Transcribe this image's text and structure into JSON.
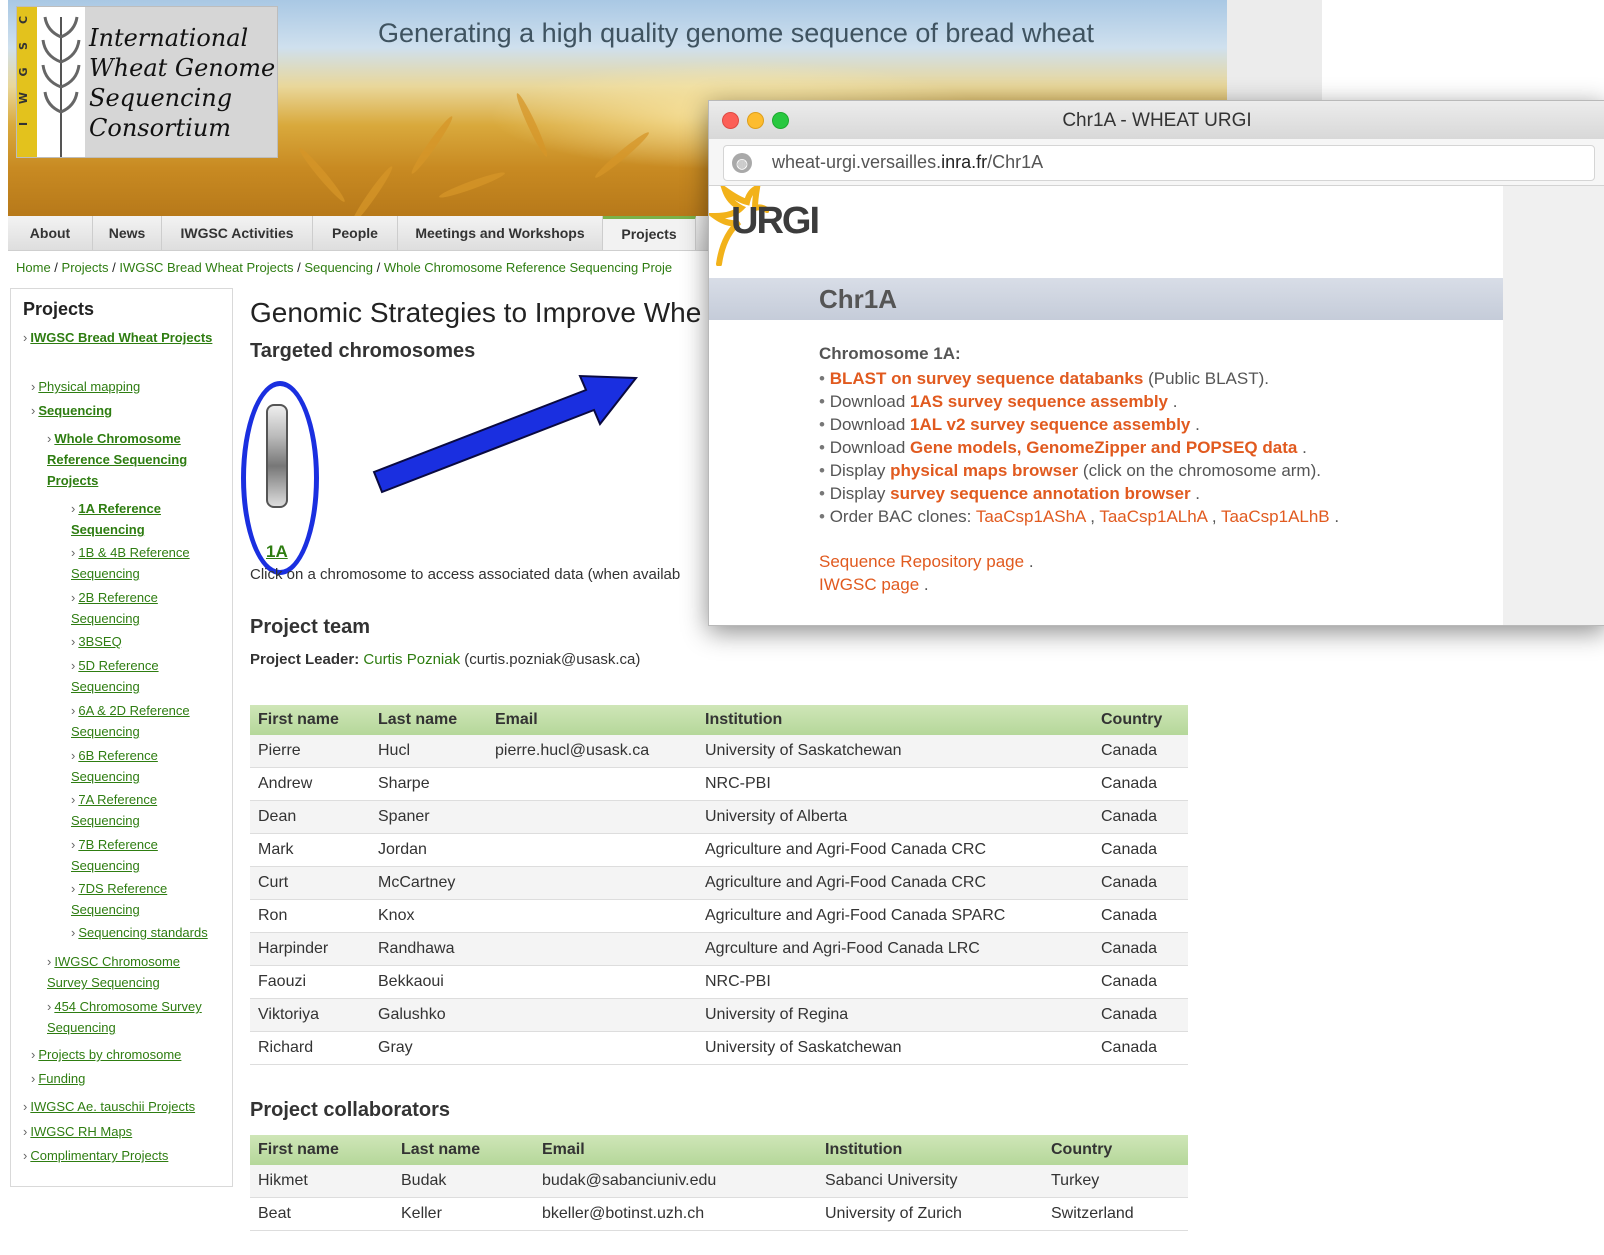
{
  "banner": {
    "logo_lines": [
      "International",
      "Wheat Genome",
      "Sequencing",
      "Consortium"
    ],
    "logo_stripe": "IWGSC",
    "title": "Generating a high quality genome sequence of bread wheat"
  },
  "nav": {
    "items": [
      "About",
      "News",
      "IWGSC Activities",
      "People",
      "Meetings and Workshops",
      "Projects"
    ],
    "active": "Projects"
  },
  "breadcrumb": [
    "Home",
    "Projects",
    "IWGSC Bread Wheat Projects",
    "Sequencing",
    "Whole Chromosome Reference Sequencing Proje"
  ],
  "sidebar": {
    "heading": "Projects",
    "items": [
      "IWGSC Bread Wheat Projects",
      "Physical mapping",
      "Sequencing",
      "Whole Chromosome Reference Sequencing Projects",
      "1A Reference Sequencing",
      "1B & 4B Reference Sequencing",
      "2B Reference Sequencing",
      "3BSEQ",
      "5D Reference Sequencing",
      "6A & 2D Reference Sequencing",
      "6B Reference Sequencing",
      "7A Reference Sequencing",
      "7B Reference Sequencing",
      "7DS Reference Sequencing",
      "Sequencing standards",
      "IWGSC Chromosome Survey Sequencing",
      "454 Chromosome Survey Sequencing",
      "Projects by chromosome",
      "Funding",
      "IWGSC Ae. tauschii Projects",
      "IWGSC RH Maps",
      "Complimentary Projects"
    ]
  },
  "main": {
    "title": "Genomic Strategies to Improve Whe",
    "targeted": "Targeted chromosomes",
    "chromosome_label": "1A",
    "click_text": "Click on a chromosome to access associated data (when availab",
    "team_heading": "Project team",
    "leader_label": "Project Leader:",
    "leader_name": "Curtis Pozniak",
    "leader_email": "(curtis.pozniak@usask.ca)",
    "team_headers": [
      "First name",
      "Last name",
      "Email",
      "Institution",
      "Country"
    ],
    "team_rows": [
      [
        "Pierre",
        "Hucl",
        "pierre.hucl@usask.ca",
        "University of Saskatchewan",
        "Canada"
      ],
      [
        "Andrew",
        "Sharpe",
        "",
        "NRC-PBI",
        "Canada"
      ],
      [
        "Dean",
        "Spaner",
        "",
        "University of Alberta",
        "Canada"
      ],
      [
        "Mark",
        "Jordan",
        "",
        "Agriculture and Agri-Food Canada CRC",
        "Canada"
      ],
      [
        "Curt",
        "McCartney",
        "",
        "Agriculture and Agri-Food Canada CRC",
        "Canada"
      ],
      [
        "Ron",
        "Knox",
        "",
        "Agriculture and Agri-Food Canada SPARC",
        "Canada"
      ],
      [
        "Harpinder",
        "Randhawa",
        "",
        "Agrculture and Agri-Food Canada LRC",
        "Canada"
      ],
      [
        "Faouzi",
        "Bekkaoui",
        "",
        "NRC-PBI",
        "Canada"
      ],
      [
        "Viktoriya",
        "Galushko",
        "",
        "University of Regina",
        "Canada"
      ],
      [
        "Richard",
        "Gray",
        "",
        "University of Saskatchewan",
        "Canada"
      ]
    ],
    "collab_heading": "Project collaborators",
    "collab_headers": [
      "First name",
      "Last name",
      "Email",
      "Institution",
      "Country"
    ],
    "collab_rows": [
      [
        "Hikmet",
        "Budak",
        "budak@sabanciuniv.edu",
        "Sabanci University",
        "Turkey"
      ],
      [
        "Beat",
        "Keller",
        "bkeller@botinst.uzh.ch",
        "University of Zurich",
        "Switzerland"
      ]
    ]
  },
  "popup": {
    "window_title": "Chr1A - WHEAT URGI",
    "url_prefix": "wheat-urgi.versailles.",
    "url_domain": "inra.fr",
    "url_suffix": "/Chr1A",
    "logo_text": "URGI",
    "header": "Chr1A",
    "chromosome_heading": "Chromosome 1A:",
    "list": {
      "l1_link": "BLAST on survey sequence databanks",
      "l1_after": " (Public BLAST).",
      "l2_before": "Download ",
      "l2_link": "1AS survey sequence assembly",
      "l3_before": "Download ",
      "l3_link": "1AL v2 survey sequence assembly",
      "l4_before": "Download ",
      "l4_link": "Gene models, GenomeZipper and POPSEQ data",
      "l5_before": "Display ",
      "l5_link": "physical maps browser",
      "l5_after": " (click on the chromosome arm).",
      "l6_before": "Display ",
      "l6_link": "survey sequence annotation browser",
      "l7_before": "Order BAC clones: ",
      "l7_links": [
        "TaaCsp1AShA",
        "TaaCsp1ALhA",
        "TaaCsp1ALhB"
      ]
    },
    "repo_link": "Sequence Repository page",
    "iwgsc_link": "IWGSC page"
  }
}
